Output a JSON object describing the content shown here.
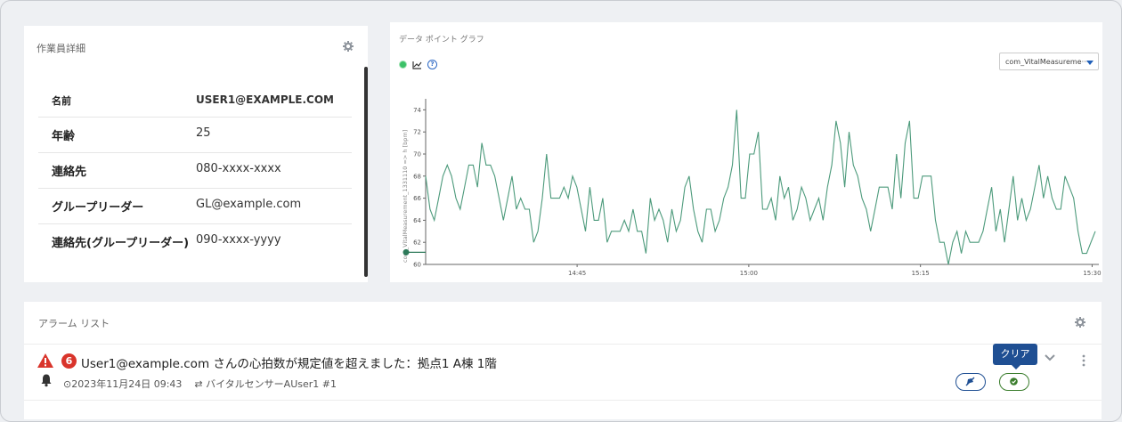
{
  "worker_detail": {
    "title": "作業員詳細",
    "rows": [
      {
        "key": "名前",
        "value": "USER1@EXAMPLE.COM"
      },
      {
        "key": "年齢",
        "value": "25"
      },
      {
        "key": "連絡先",
        "value": "080-xxxx-xxxx"
      },
      {
        "key": "グループリーダー",
        "value": "GL@example.com"
      },
      {
        "key": "連絡先(グループリーダー)",
        "value": "090-xxxx-yyyy"
      }
    ]
  },
  "graph": {
    "title": "データ ポイント グラフ",
    "select_value": "com_VitalMeasureme···"
  },
  "chart_data": {
    "type": "line",
    "ylabel": "com_VitalMeasurement_1331110 => h [bpm]",
    "ylim": [
      60,
      75
    ],
    "y_ticks": [
      "60",
      "62",
      "64",
      "66",
      "68",
      "70",
      "72",
      "74"
    ],
    "x_ticks": [
      "14:45",
      "15:00",
      "15:15",
      "15:30"
    ],
    "series": [
      {
        "color": "#4c9a7b",
        "values": [
          68,
          65,
          64,
          66,
          68,
          69,
          68,
          66,
          65,
          67,
          69,
          69,
          67,
          71,
          69,
          69,
          68,
          66,
          64,
          66,
          68,
          65,
          66,
          65,
          65,
          62,
          63,
          66,
          70,
          66,
          66,
          66,
          67,
          66,
          68,
          67,
          65,
          63,
          67,
          64,
          64,
          66,
          62,
          63,
          63,
          63,
          64,
          63,
          65,
          63,
          63,
          61,
          66,
          64,
          65,
          64,
          62,
          65,
          63,
          64,
          67,
          68,
          65,
          63,
          62,
          65,
          65,
          63,
          64,
          66,
          67,
          69,
          74,
          66,
          66,
          70,
          70,
          72,
          65,
          65,
          66,
          64,
          68,
          66,
          67,
          64,
          65,
          67,
          66,
          64,
          65,
          66,
          64,
          67,
          69,
          73,
          71,
          67,
          72,
          69,
          68,
          66,
          65,
          63,
          65,
          67,
          67,
          67,
          65,
          70,
          66,
          71,
          73,
          66,
          66,
          68,
          68,
          68,
          64,
          62,
          62,
          60,
          62,
          63,
          61,
          63,
          62,
          62,
          62,
          63,
          65,
          67,
          63,
          65,
          62,
          65,
          68,
          64,
          66,
          64,
          65,
          67,
          69,
          66,
          68,
          66,
          65,
          65,
          68,
          67,
          66,
          63,
          61,
          61,
          62,
          63
        ]
      }
    ]
  },
  "alarm_list": {
    "title": "アラーム リスト",
    "alarms": [
      {
        "count": "6",
        "message": "User1@example.com さんの心拍数が規定値を超えました：拠点1 A棟 1階",
        "datetime": "2023年11月24日 09:43",
        "source": "バイタルセンサーAUser1 #1",
        "tooltip": "クリア"
      }
    ]
  },
  "colors": {
    "line": "#4c9a7b",
    "alarm_red": "#d9342b",
    "accent_blue": "#1f4f93",
    "clear_green": "#3a7d2c"
  }
}
